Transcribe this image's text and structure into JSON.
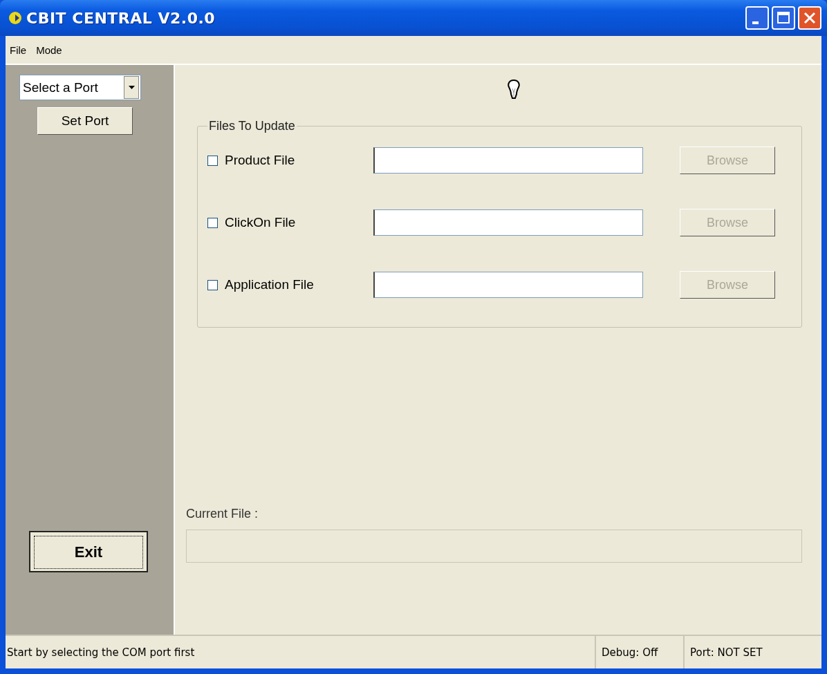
{
  "window": {
    "title": "CBIT CENTRAL V2.0.0"
  },
  "menu": [
    {
      "label": "File"
    },
    {
      "label": "Mode"
    }
  ],
  "port_select": {
    "value": "Select a Port"
  },
  "set_port_button": {
    "label": "Set Port"
  },
  "exit_button": {
    "label": "Exit"
  },
  "files_group": {
    "title": "Files To Update",
    "rows": [
      {
        "label": "Product File",
        "checked": false,
        "browse": {
          "label": "Browse",
          "disabled": true
        }
      },
      {
        "label": "ClickOn File",
        "checked": false,
        "browse": {
          "label": "Browse",
          "disabled": true
        }
      },
      {
        "label": "Application File",
        "checked": false,
        "browse": {
          "label": "Browse",
          "disabled": true
        }
      }
    ]
  },
  "current_file": {
    "label": "Current File :"
  },
  "status_bar": [
    "Start by selecting the COM port first",
    "Debug: Off",
    "Port: NOT SET"
  ]
}
